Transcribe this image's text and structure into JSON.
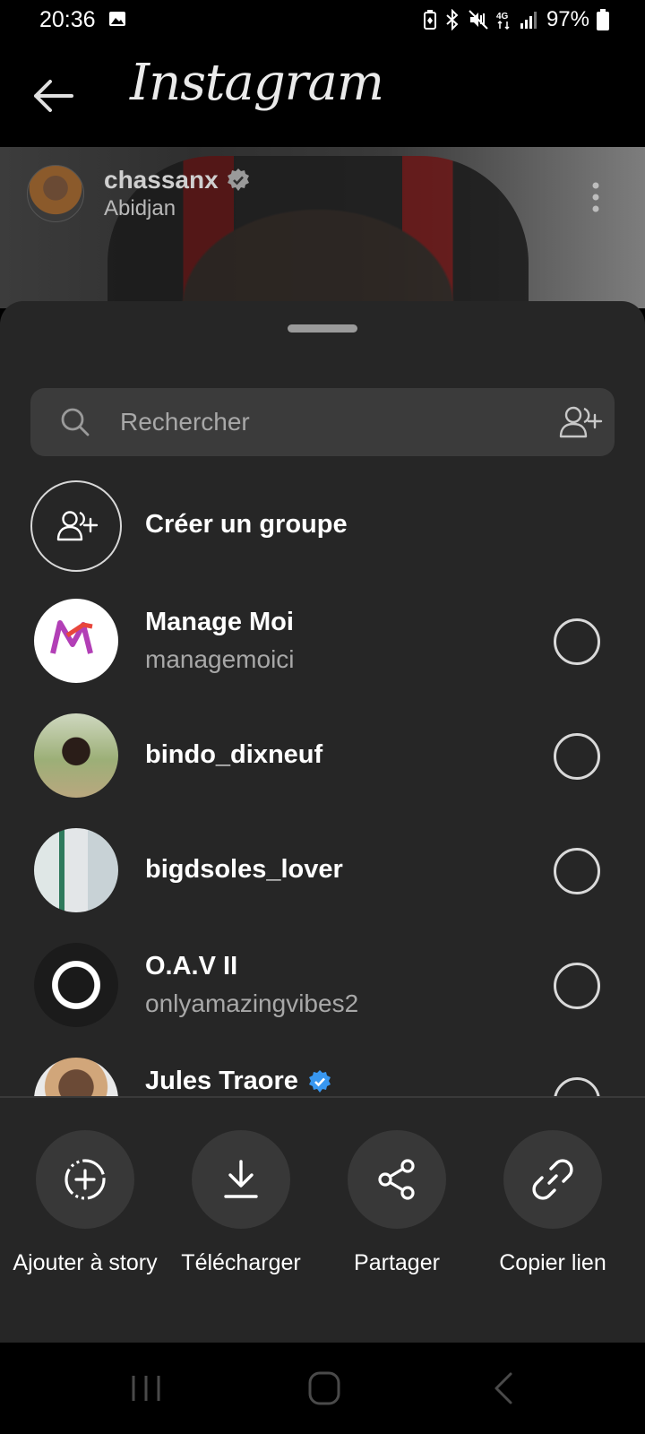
{
  "status_bar": {
    "time": "20:36",
    "battery": "97%",
    "icons": [
      "image-icon",
      "battery-saver-icon",
      "bluetooth-icon",
      "mute-icon",
      "4g-icon",
      "signal-icon",
      "battery-icon"
    ]
  },
  "header": {
    "logo": "Instagram",
    "back_icon": "arrow-left-icon"
  },
  "post": {
    "username": "chassanx",
    "location": "Abidjan"
  },
  "search": {
    "placeholder": "Rechercher"
  },
  "create_group": {
    "label": "Créer un groupe"
  },
  "contacts": [
    {
      "name": "Manage Moi",
      "username": "managemoici",
      "verified": false,
      "selected": false
    },
    {
      "name": "bindo_dixneuf",
      "username": "",
      "verified": false,
      "selected": false
    },
    {
      "name": "bigdsoles_lover",
      "username": "",
      "verified": false,
      "selected": false
    },
    {
      "name": "O.A.V II",
      "username": "onlyamazingvibes2",
      "verified": false,
      "selected": false
    },
    {
      "name": "Jules Traore",
      "username": "",
      "verified": true,
      "selected": false
    }
  ],
  "actions": [
    {
      "label": "Ajouter à story",
      "icon": "add-story-icon"
    },
    {
      "label": "Télécharger",
      "icon": "download-icon"
    },
    {
      "label": "Partager",
      "icon": "share-icon"
    },
    {
      "label": "Copier lien",
      "icon": "link-icon"
    }
  ],
  "colors": {
    "background": "#000000",
    "sheet": "#262626",
    "verified_blue": "#3897f0",
    "secondary_text": "#a8a8a8"
  }
}
